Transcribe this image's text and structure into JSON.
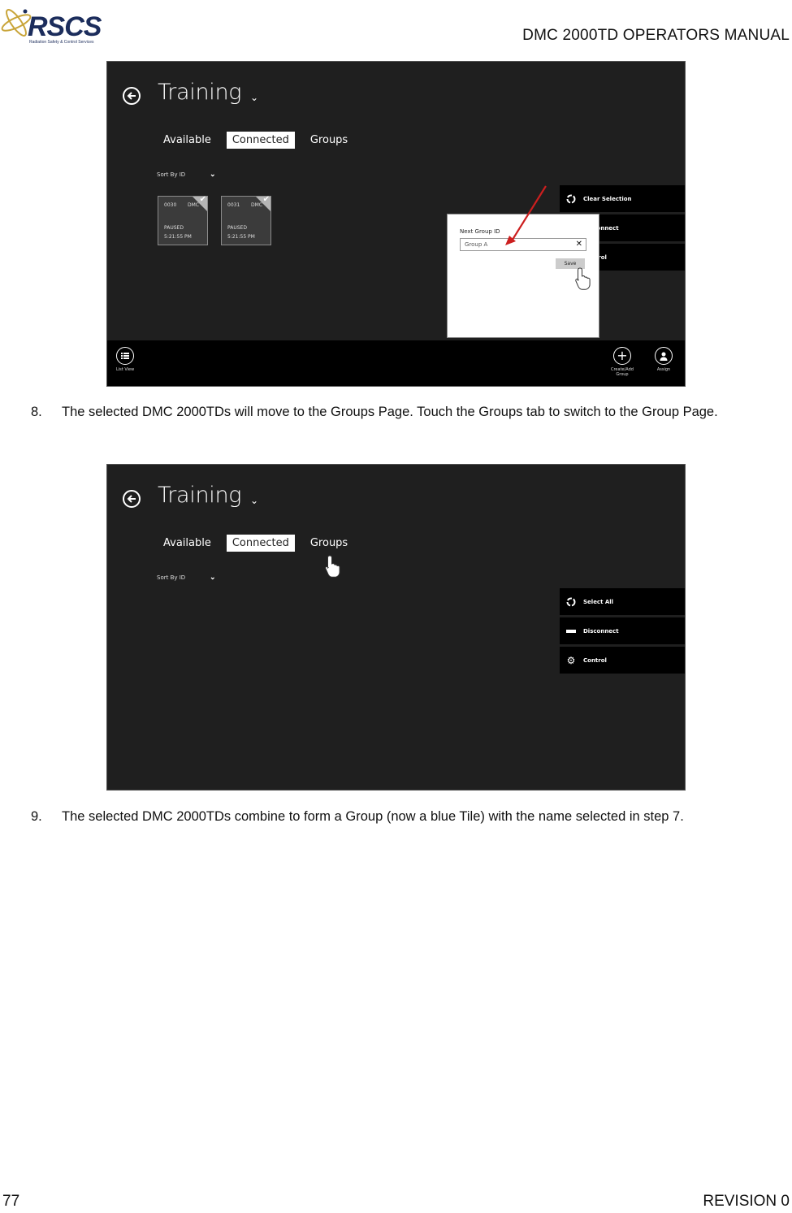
{
  "document": {
    "logo": {
      "name": "RSCS",
      "tagline": "Radiation Safety & Control Services",
      "icon": "atom-icon"
    },
    "header_title": "DMC 2000TD OPERATORS MANUAL",
    "page_number": "77",
    "revision": "REVISION 0"
  },
  "screenshot1": {
    "app_title": "Training",
    "tabs": [
      {
        "label": "Available",
        "active": false
      },
      {
        "label": "Connected",
        "active": true
      },
      {
        "label": "Groups",
        "active": false
      }
    ],
    "sort_label": "Sort By ID",
    "tiles": [
      {
        "id": "0030",
        "type": "DMC",
        "status": "PAUSED",
        "time": "5:21:55 PM",
        "selected": true
      },
      {
        "id": "0031",
        "type": "DMC",
        "status": "PAUSED",
        "time": "5:21:55 PM",
        "selected": true
      }
    ],
    "commands": [
      {
        "label": "Clear Selection",
        "icon": "clear-selection-icon"
      },
      {
        "label": "Disconnect",
        "icon": "disconnect-icon"
      },
      {
        "label": "Control",
        "icon": "gear-icon"
      }
    ],
    "dialog": {
      "label": "Next Group ID",
      "input_value": "Group A",
      "save_label": "Save"
    },
    "appbar": {
      "list_view_label": "List View",
      "create_group_label": "Create/Add Group",
      "assign_label": "Assign"
    }
  },
  "screenshot2": {
    "app_title": "Training",
    "tabs": [
      {
        "label": "Available",
        "active": false
      },
      {
        "label": "Connected",
        "active": true
      },
      {
        "label": "Groups",
        "active": false
      }
    ],
    "sort_label": "Sort By ID",
    "commands": [
      {
        "label": "Select All",
        "icon": "select-all-icon"
      },
      {
        "label": "Disconnect",
        "icon": "disconnect-icon"
      },
      {
        "label": "Control",
        "icon": "gear-icon"
      }
    ]
  },
  "steps": [
    {
      "number": "8.",
      "text": "The selected DMC 2000TDs will move to the Groups Page. Touch the Groups tab to switch to the Group Page."
    },
    {
      "number": "9.",
      "text": "The selected DMC 2000TDs combine to form a Group (now a blue Tile) with the name selected in step 7."
    }
  ]
}
